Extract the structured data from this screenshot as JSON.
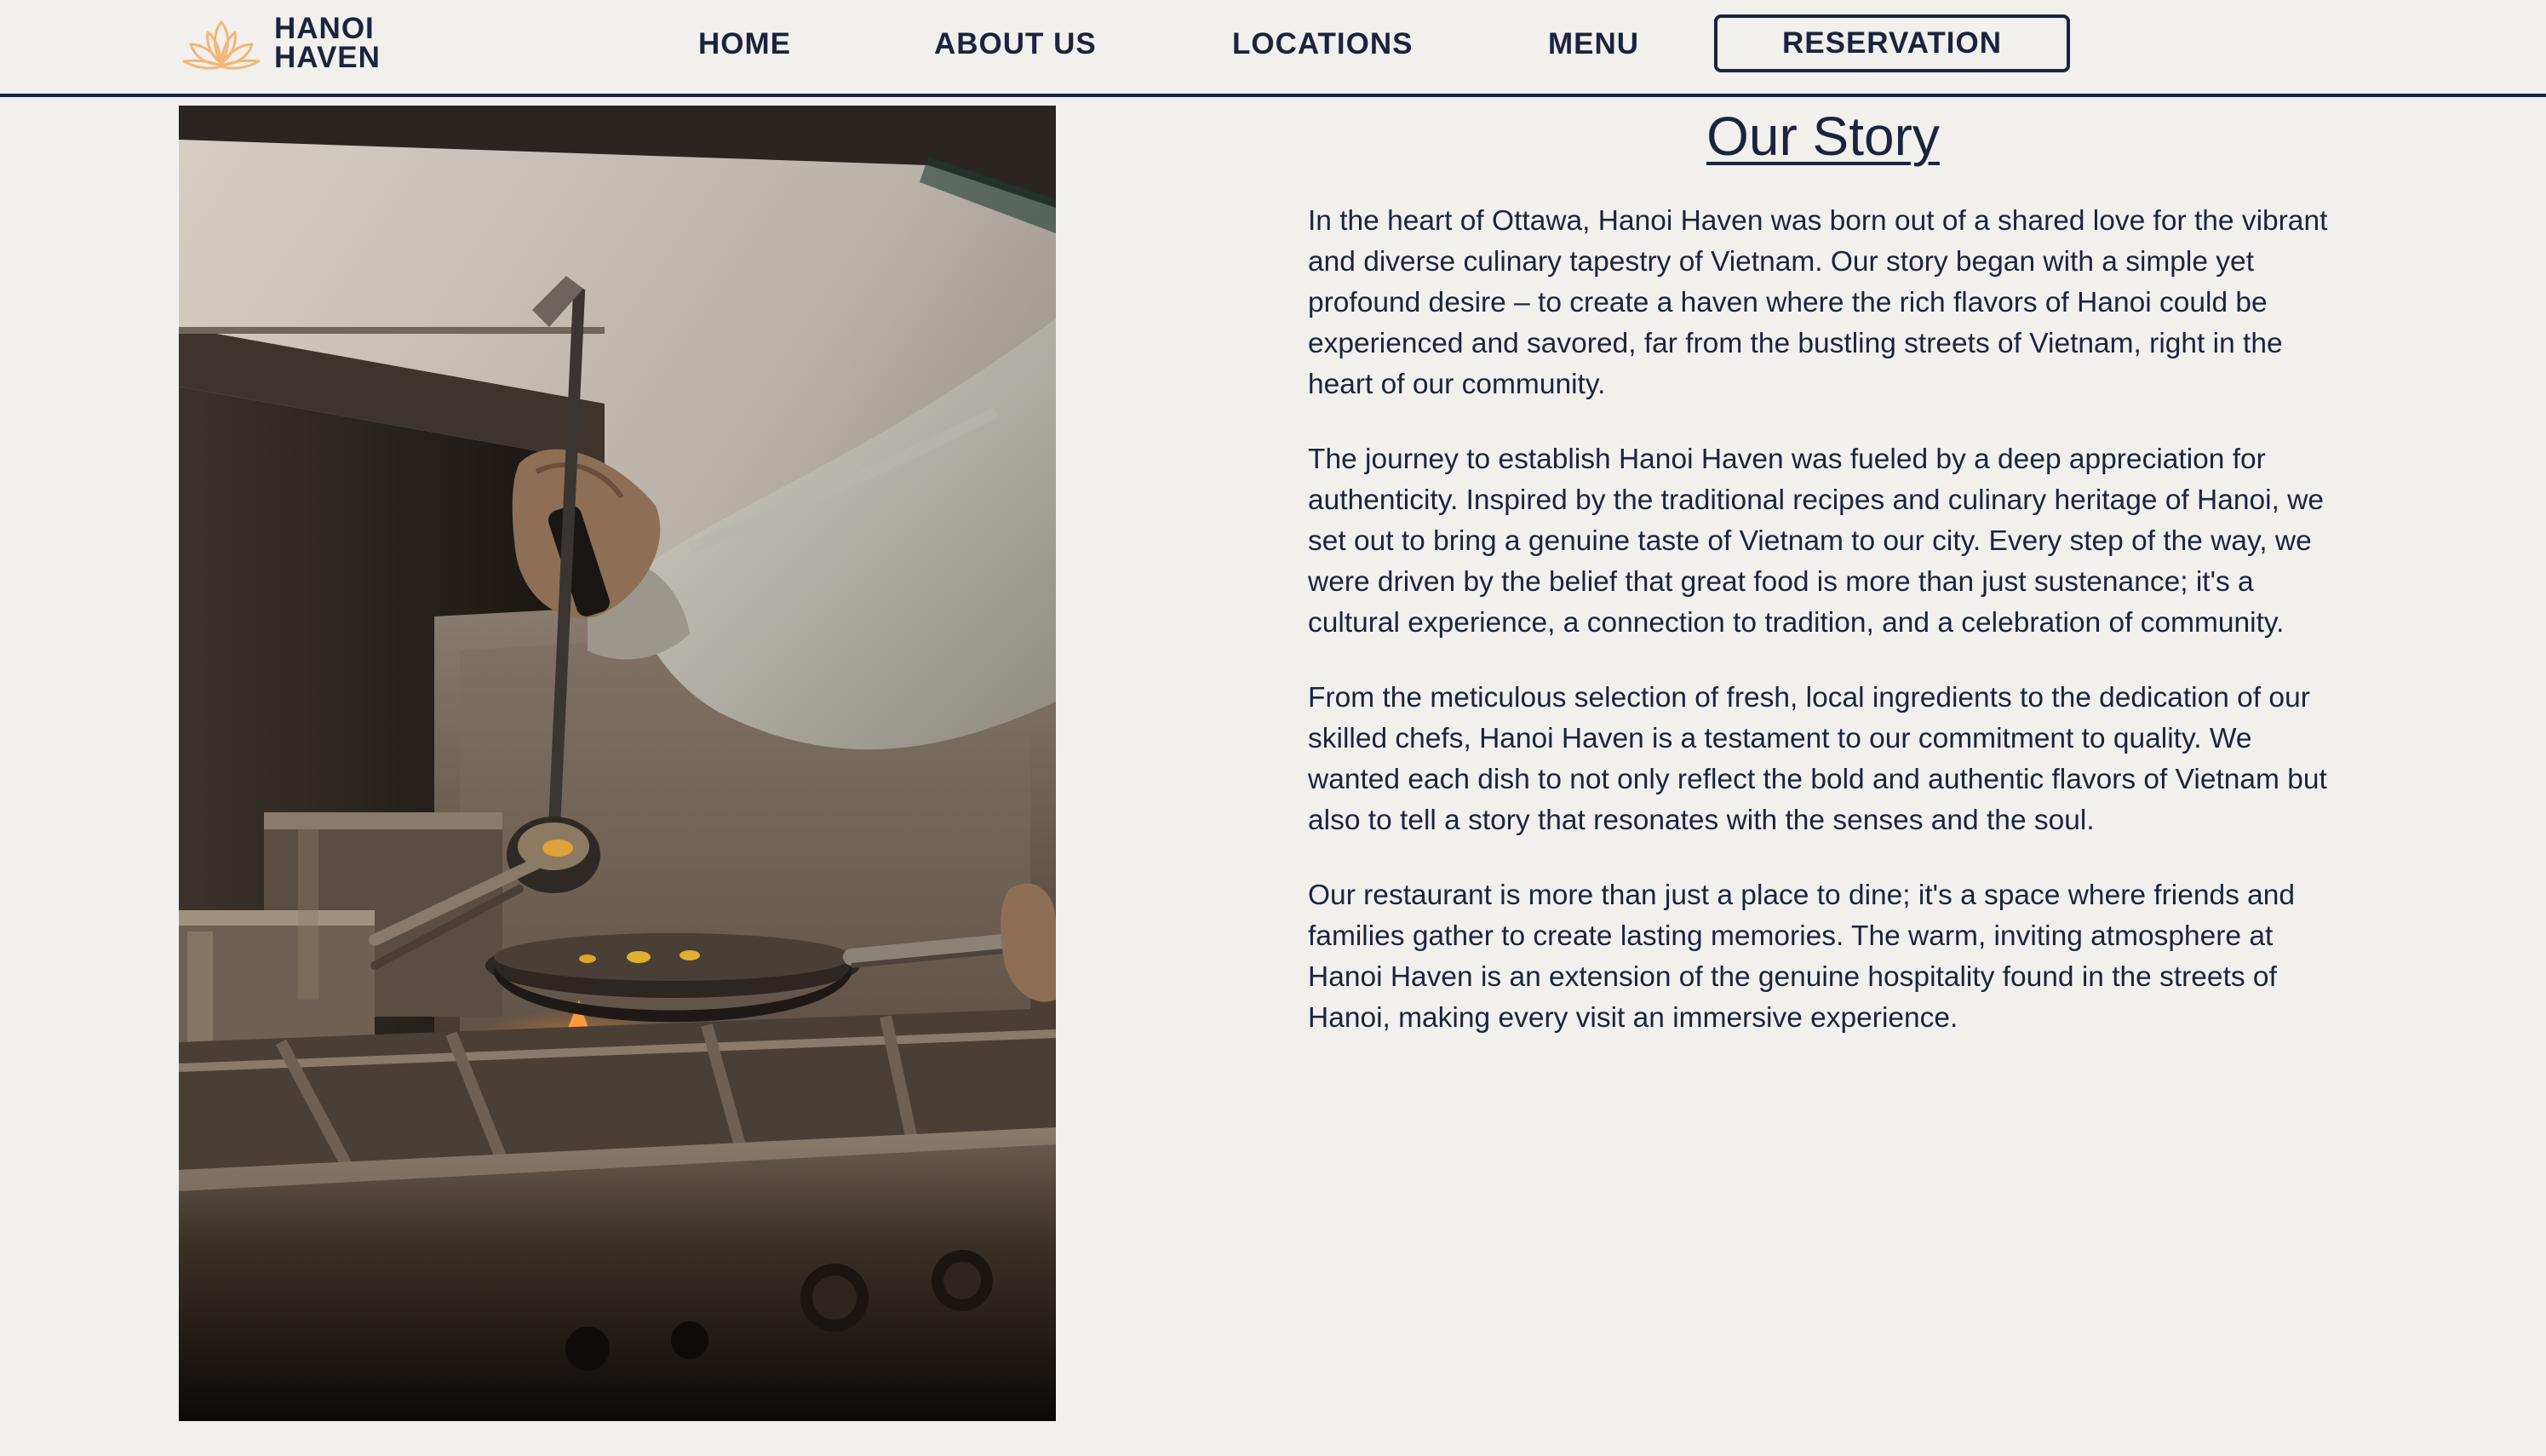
{
  "brand": {
    "name_line1": "HANOI",
    "name_line2": "HAVEN",
    "accent_color": "#f2b77a",
    "text_color": "#1c2340",
    "background_color": "#f1f0ec",
    "logo_icon": "lotus-icon"
  },
  "nav": {
    "home": "HOME",
    "about": "ABOUT US",
    "locations": "LOCATIONS",
    "menu": "MENU",
    "reservation": "RESERVATION"
  },
  "hero_image": {
    "subject": "chef-cooking-photo"
  },
  "story": {
    "title": "Our Story",
    "paragraphs": [
      "In the heart of Ottawa, Hanoi Haven was born out of a shared love for the vibrant and diverse culinary tapestry of Vietnam. Our story began with a simple yet profound desire – to create a haven where the rich flavors of Hanoi could be experienced and savored, far from the bustling streets of Vietnam, right in the heart of our community.",
      "The journey to establish Hanoi Haven was fueled by a deep appreciation for authenticity. Inspired by the traditional recipes and culinary heritage of Hanoi, we set out to bring a genuine taste of Vietnam to our city. Every step of the way, we were driven by the belief that great food is more than just sustenance; it's a cultural experience, a connection to tradition, and a celebration of community.",
      "From the meticulous selection of fresh, local ingredients to the dedication of our skilled chefs, Hanoi Haven is a testament to our commitment to quality. We wanted each dish to not only reflect the bold and authentic flavors of Vietnam but also to tell a story that resonates with the senses and the soul.",
      "Our restaurant is more than just a place to dine; it's a space where friends and families gather to create lasting memories. The warm, inviting atmosphere at Hanoi Haven is an extension of the genuine hospitality found in the streets of Hanoi, making every visit an immersive experience."
    ]
  }
}
